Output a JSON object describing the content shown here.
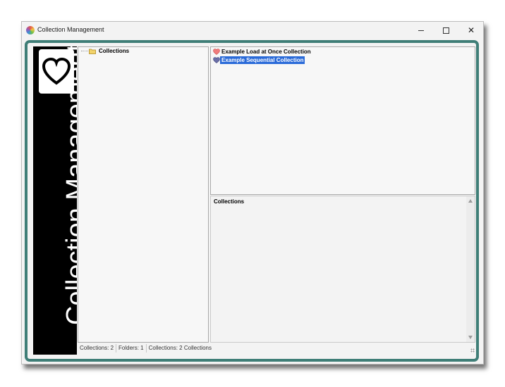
{
  "window": {
    "title": "Collection Management",
    "controls": {
      "minimize_icon": "minimize-icon",
      "maximize_icon": "maximize-icon",
      "close_icon": "close-icon",
      "close_glyph": "✕"
    }
  },
  "banner": {
    "text": "Collection Management",
    "icon": "heart-icon"
  },
  "tree": {
    "root_label": "Collections",
    "root_icon": "folder-icon"
  },
  "collections_list": {
    "items": [
      {
        "label": "Example Load at Once Collection",
        "icon": "heart-icon",
        "selected": false
      },
      {
        "label": "Example Sequential Collection",
        "icon": "sequential-heart-icon",
        "selected": true
      }
    ]
  },
  "detail": {
    "title": "Collections"
  },
  "status": {
    "collections": "Collections: 2",
    "folders": "Folders: 1",
    "summary": "Collections: 2 Collections"
  },
  "colors": {
    "frame": "#3f7e77",
    "selection": "#2a6ad8",
    "banner_bg": "#000000"
  }
}
